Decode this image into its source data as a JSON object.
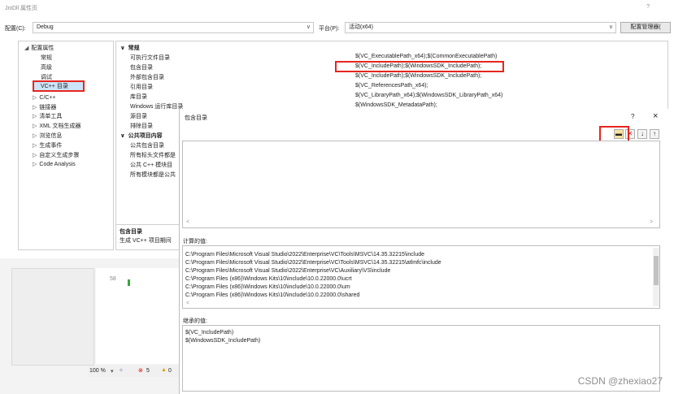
{
  "window": {
    "title": "JniDll 属性页",
    "help": "?"
  },
  "toolbar": {
    "config_label": "配置(C):",
    "config_value": "Debug",
    "platform_label": "平台(P):",
    "platform_value": "活动(x64)",
    "config_manager": "配置管理器("
  },
  "tree": {
    "root": "配置属性",
    "items": [
      "常规",
      "高级",
      "调试",
      "VC++ 目录",
      "C/C++",
      "链接器",
      "清单工具",
      "XML 文档生成器",
      "浏览信息",
      "生成事件",
      "自定义生成步骤",
      "Code Analysis"
    ]
  },
  "grid": {
    "section_general": "常规",
    "rows": [
      {
        "name": "可执行文件目录",
        "value": "$(VC_ExecutablePath_x64);$(CommonExecutablePath)"
      },
      {
        "name": "包含目录",
        "value": "$(VC_IncludePath);$(WindowsSDK_IncludePath);"
      },
      {
        "name": "外部包含目录",
        "value": "$(VC_IncludePath);$(WindowsSDK_IncludePath);"
      },
      {
        "name": "引用目录",
        "value": "$(VC_ReferencesPath_x64);"
      },
      {
        "name": "库目录",
        "value": "$(VC_LibraryPath_x64);$(WindowsSDK_LibraryPath_x64)"
      },
      {
        "name": "Windows 运行库目录",
        "value": "$(WindowsSDK_MetadataPath);"
      },
      {
        "name": "源目录",
        "value": ""
      },
      {
        "name": "排除目录",
        "value": ""
      }
    ],
    "section_public": "公共项目内容",
    "public_rows": [
      "公共包含目录",
      "所有标头文件都是",
      "公共 C++ 模块目",
      "所有模块都是公共"
    ],
    "desc_title": "包含目录",
    "desc_text": "生成 VC++ 项目期间"
  },
  "lower": {
    "zoom": "100 %",
    "errors": "5",
    "warnings": "0",
    "line_no": "58"
  },
  "dialog": {
    "title": "包含目录",
    "help": "?",
    "close": "×",
    "eval_label": "计算的值:",
    "eval_lines": [
      "C:\\Program Files\\Microsoft Visual Studio\\2022\\Enterprise\\VC\\Tools\\MSVC\\14.35.32215\\include",
      "C:\\Program Files\\Microsoft Visual Studio\\2022\\Enterprise\\VC\\Tools\\MSVC\\14.35.32215\\atlmfc\\include",
      "C:\\Program Files\\Microsoft Visual Studio\\2022\\Enterprise\\VC\\Auxiliary\\VS\\include",
      "C:\\Program Files (x86)\\Windows Kits\\10\\include\\10.0.22000.0\\ucrt",
      "C:\\Program Files (x86)\\Windows Kits\\10\\include\\10.0.22000.0\\um",
      "C:\\Program Files (x86)\\Windows Kits\\10\\include\\10.0.22000.0\\shared"
    ],
    "inherit_label": "继承的值:",
    "inherit_lines": [
      "$(VC_IncludePath)",
      "$(WindowsSDK_IncludePath)"
    ]
  },
  "watermark": "CSDN @zhexiao27",
  "colors": {
    "highlight_box": "#e5261f",
    "selection": "#cce4f7"
  }
}
